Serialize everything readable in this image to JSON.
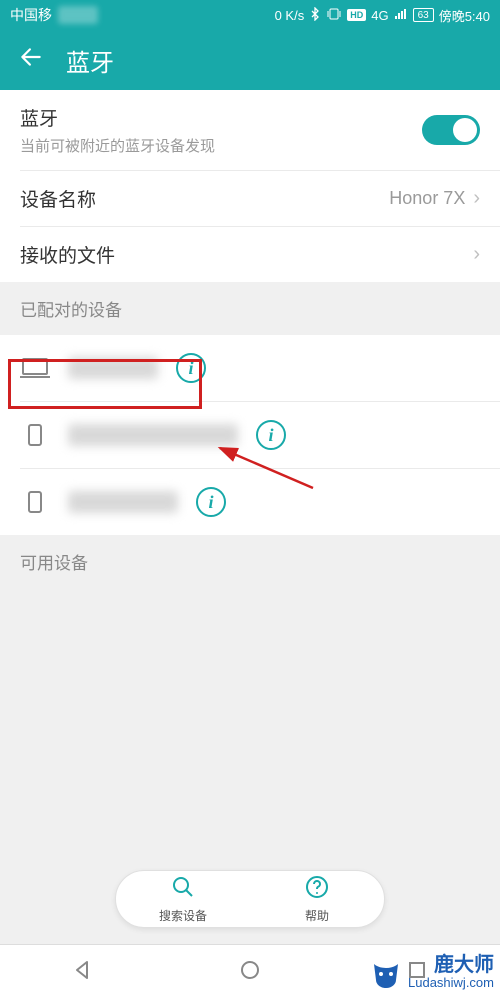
{
  "status_bar": {
    "carrier": "中国移",
    "data_rate": "0 K/s",
    "hd_badge": "HD",
    "signal_type": "4G",
    "battery": "63",
    "time": "傍晚5:40"
  },
  "header": {
    "title": "蓝牙"
  },
  "bluetooth_toggle": {
    "label": "蓝牙",
    "subtitle": "当前可被附近的蓝牙设备发现",
    "enabled": true
  },
  "device_name_row": {
    "label": "设备名称",
    "value": "Honor 7X"
  },
  "received_files_row": {
    "label": "接收的文件"
  },
  "sections": {
    "paired_header": "已配对的设备",
    "available_header": "可用设备"
  },
  "paired_devices": [
    {
      "type": "laptop"
    },
    {
      "type": "phone"
    },
    {
      "type": "phone"
    }
  ],
  "bottom_actions": {
    "search": {
      "label": "搜索设备"
    },
    "help": {
      "label": "帮助"
    }
  },
  "watermark": {
    "brand_cn": "鹿大师",
    "url": "Ludashiwj.com"
  },
  "annotation": {
    "highlight_device_index": 0,
    "arrow_present": true
  },
  "colors": {
    "accent": "#18a9a9",
    "highlight": "#d02020",
    "watermark": "#1e5fb3"
  }
}
